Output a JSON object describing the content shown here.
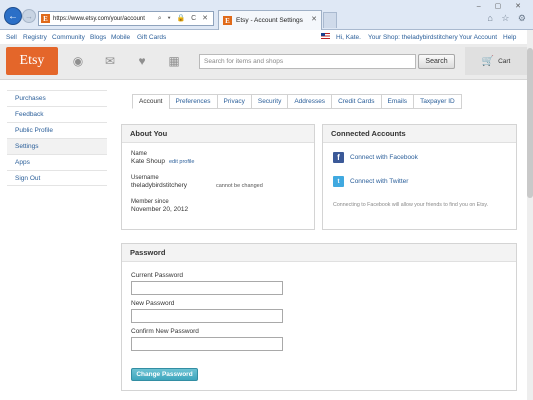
{
  "browser": {
    "url": "https://www.etsy.com/your/account",
    "tab_title": "Etsy - Account Settings",
    "favicon_letter": "E",
    "back_icon": "←",
    "forward_icon": "→",
    "addr_icons": "⌕ ▾ 🔒 C ✕",
    "tab_close": "✕",
    "window_controls": "– ▢ ✕",
    "browser_icons": "⌂ ☆ ⚙"
  },
  "top_links": {
    "sell": "Sell",
    "registry": "Registry",
    "community": "Community",
    "blogs": "Blogs",
    "mobile": "Mobile",
    "gift_cards": "Gift Cards",
    "greeting": "Hi, Kate.",
    "your_shop": "Your Shop: theladybirdstitchery",
    "your_account": "Your Account",
    "help": "Help"
  },
  "header": {
    "logo": "Etsy",
    "icons": {
      "profile": "◉",
      "messages": "✉",
      "favorites": "♥",
      "shop": "▦"
    },
    "search_placeholder": "Search for items and shops",
    "search_button": "Search",
    "cart_label": "Cart",
    "cart_icon": "🛒"
  },
  "sidebar": {
    "items": [
      {
        "label": "Purchases"
      },
      {
        "label": "Feedback"
      },
      {
        "label": "Public Profile"
      },
      {
        "label": "Settings"
      },
      {
        "label": "Apps"
      },
      {
        "label": "Sign Out"
      }
    ]
  },
  "settings_tabs": [
    {
      "label": "Account"
    },
    {
      "label": "Preferences"
    },
    {
      "label": "Privacy"
    },
    {
      "label": "Security"
    },
    {
      "label": "Addresses"
    },
    {
      "label": "Credit Cards"
    },
    {
      "label": "Emails"
    },
    {
      "label": "Taxpayer ID"
    }
  ],
  "about": {
    "title": "About You",
    "name_label": "Name",
    "name_value": "Kate Shoup",
    "edit_profile": "edit profile",
    "username_label": "Username",
    "username_value": "theladybirdstitchery",
    "username_note": "cannot be changed",
    "member_label": "Member since",
    "member_value": "November 20, 2012"
  },
  "connected": {
    "title": "Connected Accounts",
    "facebook": "Connect with Facebook",
    "twitter": "Connect with Twitter",
    "facebook_icon": "f",
    "twitter_icon": "t",
    "note": "Connecting to Facebook will allow your friends to find you on Etsy."
  },
  "password": {
    "title": "Password",
    "current_label": "Current Password",
    "new_label": "New Password",
    "confirm_label": "Confirm New Password",
    "button": "Change Password"
  }
}
